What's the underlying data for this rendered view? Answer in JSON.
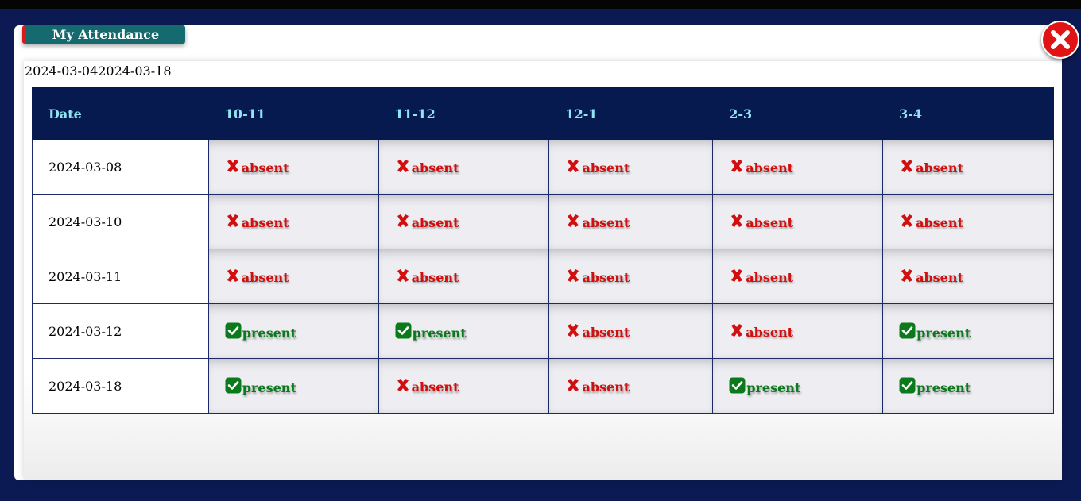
{
  "modal": {
    "title": "My Attendance",
    "date_from": "2024-03-04",
    "date_to": "2024-03-18"
  },
  "table": {
    "headers": [
      "Date",
      "10-11",
      "11-12",
      "12-1",
      "2-3",
      "3-4"
    ],
    "rows": [
      {
        "date": "2024-03-08",
        "cells": [
          "absent",
          "absent",
          "absent",
          "absent",
          "absent"
        ]
      },
      {
        "date": "2024-03-10",
        "cells": [
          "absent",
          "absent",
          "absent",
          "absent",
          "absent"
        ]
      },
      {
        "date": "2024-03-11",
        "cells": [
          "absent",
          "absent",
          "absent",
          "absent",
          "absent"
        ]
      },
      {
        "date": "2024-03-12",
        "cells": [
          "present",
          "present",
          "absent",
          "absent",
          "present"
        ]
      },
      {
        "date": "2024-03-18",
        "cells": [
          "present",
          "absent",
          "absent",
          "present",
          "present"
        ]
      }
    ]
  },
  "colors": {
    "page_bg": "#0b1a52",
    "header_bg": "#061a50",
    "header_text": "#8fe6f2",
    "absent": "#d10f0f",
    "present": "#0b7a1c",
    "title_tab": "#146a6e",
    "close": "#e01414"
  },
  "icons": {
    "absent": "x-mark-icon",
    "present": "check-square-icon",
    "close": "close-icon"
  }
}
